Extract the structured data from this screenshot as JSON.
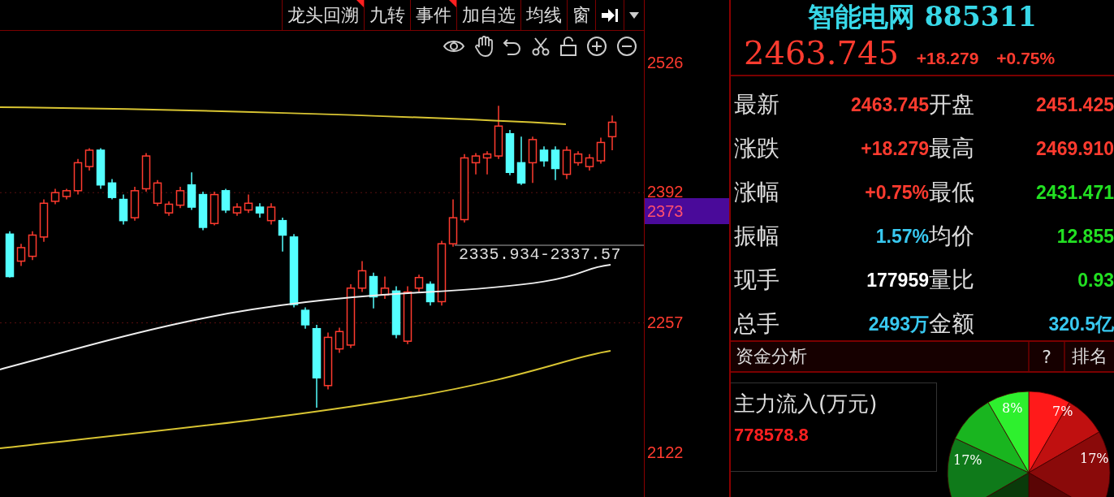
{
  "toolbar": {
    "buttons": [
      {
        "label": "龙头回溯",
        "flagged": true
      },
      {
        "label": "九转",
        "flagged": false
      },
      {
        "label": "事件",
        "flagged": true
      },
      {
        "label": "加自选",
        "flagged": false
      },
      {
        "label": "均线",
        "flagged": false
      },
      {
        "label": "窗",
        "flagged": false
      }
    ]
  },
  "chart": {
    "price_marker": "2335.934-2337.57",
    "current_price_label": "2373",
    "chart_data": {
      "type": "candlestick",
      "ohlc": [
        [
          2349,
          2352,
          2304,
          2305
        ],
        [
          2321,
          2339,
          2316,
          2335
        ],
        [
          2326,
          2352,
          2322,
          2348
        ],
        [
          2346,
          2385,
          2341,
          2381
        ],
        [
          2383,
          2396,
          2380,
          2392
        ],
        [
          2388,
          2396,
          2385,
          2394
        ],
        [
          2394,
          2427,
          2390,
          2423
        ],
        [
          2419,
          2438,
          2415,
          2436
        ],
        [
          2436,
          2438,
          2396,
          2400
        ],
        [
          2402,
          2406,
          2385,
          2387
        ],
        [
          2385,
          2390,
          2359,
          2363
        ],
        [
          2366,
          2398,
          2363,
          2394
        ],
        [
          2396,
          2433,
          2393,
          2430
        ],
        [
          2381,
          2405,
          2378,
          2402
        ],
        [
          2371,
          2383,
          2368,
          2380
        ],
        [
          2379,
          2398,
          2376,
          2394
        ],
        [
          2400,
          2413,
          2374,
          2377
        ],
        [
          2390,
          2393,
          2353,
          2356
        ],
        [
          2360,
          2393,
          2358,
          2390
        ],
        [
          2394,
          2396,
          2371,
          2374
        ],
        [
          2371,
          2381,
          2368,
          2377
        ],
        [
          2374,
          2390,
          2371,
          2381
        ],
        [
          2377,
          2381,
          2366,
          2371
        ],
        [
          2363,
          2381,
          2359,
          2377
        ],
        [
          2363,
          2366,
          2331,
          2348
        ],
        [
          2346,
          2349,
          2273,
          2276
        ],
        [
          2270,
          2273,
          2251,
          2255
        ],
        [
          2251,
          2255,
          2169,
          2200
        ],
        [
          2192,
          2247,
          2188,
          2242
        ],
        [
          2230,
          2252,
          2226,
          2248
        ],
        [
          2234,
          2297,
          2231,
          2293
        ],
        [
          2293,
          2321,
          2289,
          2311
        ],
        [
          2305,
          2309,
          2272,
          2284
        ],
        [
          2286,
          2305,
          2282,
          2293
        ],
        [
          2290,
          2295,
          2241,
          2245
        ],
        [
          2238,
          2295,
          2235,
          2289
        ],
        [
          2293,
          2307,
          2289,
          2304
        ],
        [
          2297,
          2300,
          2275,
          2279
        ],
        [
          2279,
          2342,
          2275,
          2339
        ],
        [
          2339,
          2385,
          2336,
          2366
        ],
        [
          2364,
          2432,
          2361,
          2428
        ],
        [
          2423,
          2433,
          2411,
          2430
        ],
        [
          2428,
          2435,
          2411,
          2432
        ],
        [
          2430,
          2482,
          2427,
          2461
        ],
        [
          2453,
          2457,
          2410,
          2413
        ],
        [
          2423,
          2450,
          2400,
          2402
        ],
        [
          2423,
          2450,
          2402,
          2447
        ],
        [
          2436,
          2440,
          2419,
          2425
        ],
        [
          2436,
          2440,
          2405,
          2417
        ],
        [
          2411,
          2440,
          2406,
          2436
        ],
        [
          2423,
          2435,
          2420,
          2432
        ],
        [
          2419,
          2432,
          2415,
          2428
        ],
        [
          2425,
          2449,
          2422,
          2444
        ],
        [
          2450,
          2472,
          2436,
          2465
        ]
      ],
      "ylim": [
        2076.5,
        2559.7
      ],
      "yticks": [
        2526,
        2392,
        2257,
        2122
      ]
    }
  },
  "quote": {
    "name": "智能电网",
    "code": "885311",
    "price": "2463.745",
    "change": "+18.279",
    "percent": "+0.75%"
  },
  "stats": [
    {
      "label": "最新",
      "value": "2463.745",
      "color": "#ff3b2f"
    },
    {
      "label": "开盘",
      "value": "2451.425",
      "color": "#ff3b2f"
    },
    {
      "label": "涨跌",
      "value": "+18.279",
      "color": "#ff3b2f"
    },
    {
      "label": "最高",
      "value": "2469.910",
      "color": "#ff3b2f"
    },
    {
      "label": "涨幅",
      "value": "+0.75%",
      "color": "#ff3b2f"
    },
    {
      "label": "最低",
      "value": "2431.471",
      "color": "#22e022"
    },
    {
      "label": "振幅",
      "value": "1.57%",
      "color": "#38c8f0"
    },
    {
      "label": "均价",
      "value": "12.855",
      "color": "#22e022"
    },
    {
      "label": "现手",
      "value": "177959",
      "color": "#ffffff"
    },
    {
      "label": "量比",
      "value": "0.93",
      "color": "#22e022"
    },
    {
      "label": "总手",
      "value": "2493万",
      "color": "#38c8f0"
    },
    {
      "label": "金额",
      "value": "320.5亿",
      "color": "#38c8f0"
    }
  ],
  "fund_analysis": {
    "title": "资金分析",
    "help": "?",
    "rank": "排名",
    "main_inflow_label": "主力流入(万元)",
    "main_inflow_value": "778578.8",
    "pie_labels": [
      "8%",
      "7%",
      "17%",
      "17%"
    ]
  }
}
